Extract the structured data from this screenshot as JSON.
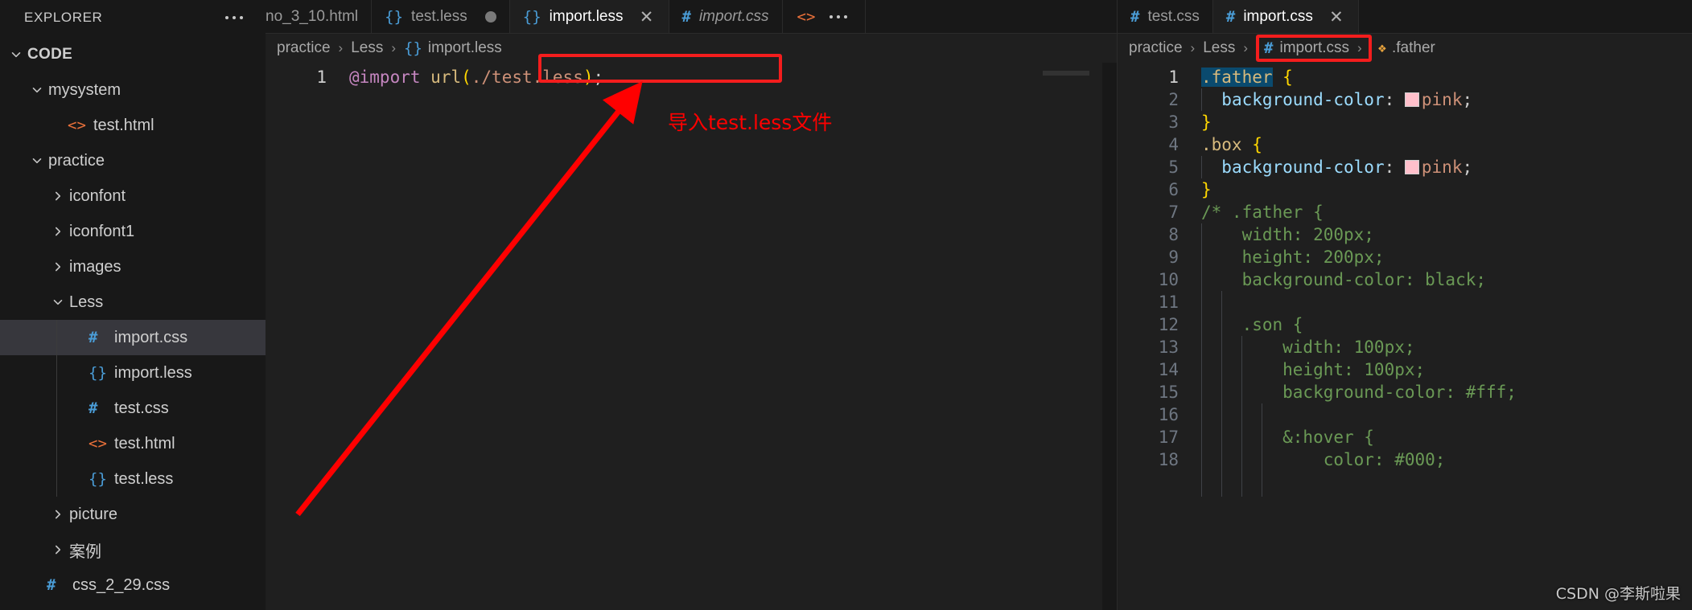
{
  "sidebar": {
    "title": "EXPLORER",
    "more_icon": "more-horizontal-icon",
    "items": [
      {
        "label": "CODE",
        "depth": 0,
        "twisty": "down",
        "icon": "",
        "selected": false
      },
      {
        "label": "mysystem",
        "depth": 1,
        "twisty": "down",
        "icon": "",
        "selected": false
      },
      {
        "label": "test.html",
        "depth": 2,
        "twisty": "none",
        "icon": "html",
        "selected": false
      },
      {
        "label": "practice",
        "depth": 1,
        "twisty": "down",
        "icon": "",
        "selected": false
      },
      {
        "label": "iconfont",
        "depth": 2,
        "twisty": "right",
        "icon": "",
        "selected": false
      },
      {
        "label": "iconfont1",
        "depth": 2,
        "twisty": "right",
        "icon": "",
        "selected": false
      },
      {
        "label": "images",
        "depth": 2,
        "twisty": "right",
        "icon": "",
        "selected": false
      },
      {
        "label": "Less",
        "depth": 2,
        "twisty": "down",
        "icon": "",
        "selected": false
      },
      {
        "label": "import.css",
        "depth": 3,
        "twisty": "none",
        "icon": "css",
        "selected": true
      },
      {
        "label": "import.less",
        "depth": 3,
        "twisty": "none",
        "icon": "less",
        "selected": false
      },
      {
        "label": "test.css",
        "depth": 3,
        "twisty": "none",
        "icon": "css",
        "selected": false
      },
      {
        "label": "test.html",
        "depth": 3,
        "twisty": "none",
        "icon": "html",
        "selected": false
      },
      {
        "label": "test.less",
        "depth": 3,
        "twisty": "none",
        "icon": "less",
        "selected": false
      },
      {
        "label": "picture",
        "depth": 2,
        "twisty": "right",
        "icon": "",
        "selected": false
      },
      {
        "label": "案例",
        "depth": 2,
        "twisty": "right",
        "icon": "",
        "selected": false
      },
      {
        "label": "css_2_29.css",
        "depth": 1,
        "twisty": "none",
        "icon": "css",
        "selected": false
      }
    ]
  },
  "left_pane": {
    "tabs": [
      {
        "label": "no_3_10.html",
        "icon": "",
        "active": false,
        "italic": false,
        "dirty": false,
        "close": false,
        "clipped": true
      },
      {
        "label": "test.less",
        "icon": "less",
        "active": false,
        "italic": false,
        "dirty": true,
        "close": false,
        "clipped": false
      },
      {
        "label": "import.less",
        "icon": "less",
        "active": true,
        "italic": false,
        "dirty": false,
        "close": true,
        "clipped": false
      },
      {
        "label": "import.css",
        "icon": "css",
        "active": false,
        "italic": true,
        "dirty": false,
        "close": false,
        "clipped": false
      }
    ],
    "tab_actions": {
      "html_preview_icon": "code-brackets-icon",
      "more_icon": "more-horizontal-icon"
    },
    "breadcrumb": [
      {
        "label": "practice",
        "glyph": ""
      },
      {
        "label": "Less",
        "glyph": ""
      },
      {
        "label": "import.less",
        "glyph": "less"
      }
    ],
    "gutter": [
      "1"
    ],
    "code": [
      {
        "tokens": [
          {
            "text": "@import",
            "cls": "t-at"
          },
          {
            "text": " ",
            "cls": "t-white"
          },
          {
            "text": "url",
            "cls": "t-fn"
          },
          {
            "text": "(",
            "cls": "t-paren"
          },
          {
            "text": "./test.less",
            "cls": "t-str"
          },
          {
            "text": ")",
            "cls": "t-paren"
          },
          {
            "text": ";",
            "cls": "t-punct"
          }
        ]
      }
    ]
  },
  "right_pane": {
    "tabs": [
      {
        "label": "test.css",
        "icon": "css",
        "active": false,
        "italic": false,
        "dirty": false,
        "close": false
      },
      {
        "label": "import.css",
        "icon": "css",
        "active": true,
        "italic": false,
        "dirty": false,
        "close": true
      }
    ],
    "breadcrumb": [
      {
        "label": "practice",
        "glyph": ""
      },
      {
        "label": "Less",
        "glyph": ""
      },
      {
        "label": "import.css",
        "glyph": "css"
      },
      {
        "label": ".father",
        "glyph": "symbol"
      }
    ],
    "gutter": [
      "1",
      "2",
      "3",
      "4",
      "5",
      "6",
      "7",
      "8",
      "9",
      "10",
      "11",
      "12",
      "13",
      "14",
      "15",
      "16",
      "17",
      "18"
    ],
    "code": [
      {
        "tokens": [
          {
            "text": ".father",
            "cls": "t-sel sel-hl"
          },
          {
            "text": " ",
            "cls": "t-white"
          },
          {
            "text": "{",
            "cls": "t-brace"
          }
        ]
      },
      {
        "tokens": [
          {
            "text": "  ",
            "cls": "t-white"
          },
          {
            "text": "background-color",
            "cls": "t-prop"
          },
          {
            "text": ": ",
            "cls": "t-punct"
          },
          {
            "text": "__SWATCH__",
            "cls": "swatch"
          },
          {
            "text": "pink",
            "cls": "t-val"
          },
          {
            "text": ";",
            "cls": "t-punct"
          }
        ]
      },
      {
        "tokens": [
          {
            "text": "}",
            "cls": "t-brace"
          }
        ]
      },
      {
        "tokens": [
          {
            "text": ".box",
            "cls": "t-sel"
          },
          {
            "text": " ",
            "cls": "t-white"
          },
          {
            "text": "{",
            "cls": "t-brace"
          }
        ]
      },
      {
        "tokens": [
          {
            "text": "  ",
            "cls": "t-white"
          },
          {
            "text": "background-color",
            "cls": "t-prop"
          },
          {
            "text": ": ",
            "cls": "t-punct"
          },
          {
            "text": "__SWATCH__",
            "cls": "swatch"
          },
          {
            "text": "pink",
            "cls": "t-val"
          },
          {
            "text": ";",
            "cls": "t-punct"
          }
        ]
      },
      {
        "tokens": [
          {
            "text": "}",
            "cls": "t-brace"
          }
        ]
      },
      {
        "tokens": [
          {
            "text": "/* .father {",
            "cls": "t-comment"
          }
        ]
      },
      {
        "tokens": [
          {
            "text": "    width: 200px;",
            "cls": "t-comment"
          }
        ]
      },
      {
        "tokens": [
          {
            "text": "    height: 200px;",
            "cls": "t-comment"
          }
        ]
      },
      {
        "tokens": [
          {
            "text": "    background-color: black;",
            "cls": "t-comment"
          }
        ]
      },
      {
        "tokens": [
          {
            "text": "",
            "cls": "t-comment"
          }
        ]
      },
      {
        "tokens": [
          {
            "text": "    .son {",
            "cls": "t-comment"
          }
        ]
      },
      {
        "tokens": [
          {
            "text": "        width: 100px;",
            "cls": "t-comment"
          }
        ]
      },
      {
        "tokens": [
          {
            "text": "        height: 100px;",
            "cls": "t-comment"
          }
        ]
      },
      {
        "tokens": [
          {
            "text": "        background-color: #fff;",
            "cls": "t-comment"
          }
        ]
      },
      {
        "tokens": [
          {
            "text": "",
            "cls": "t-comment"
          }
        ]
      },
      {
        "tokens": [
          {
            "text": "        &:hover {",
            "cls": "t-comment"
          }
        ]
      },
      {
        "tokens": [
          {
            "text": "            color: #000;",
            "cls": "t-comment"
          }
        ]
      }
    ]
  },
  "annotations": {
    "note_text": "导入test.less文件",
    "note_color": "#ff0000",
    "box_color": "#f41d1d",
    "watermark": "CSDN @李斯啦果"
  }
}
